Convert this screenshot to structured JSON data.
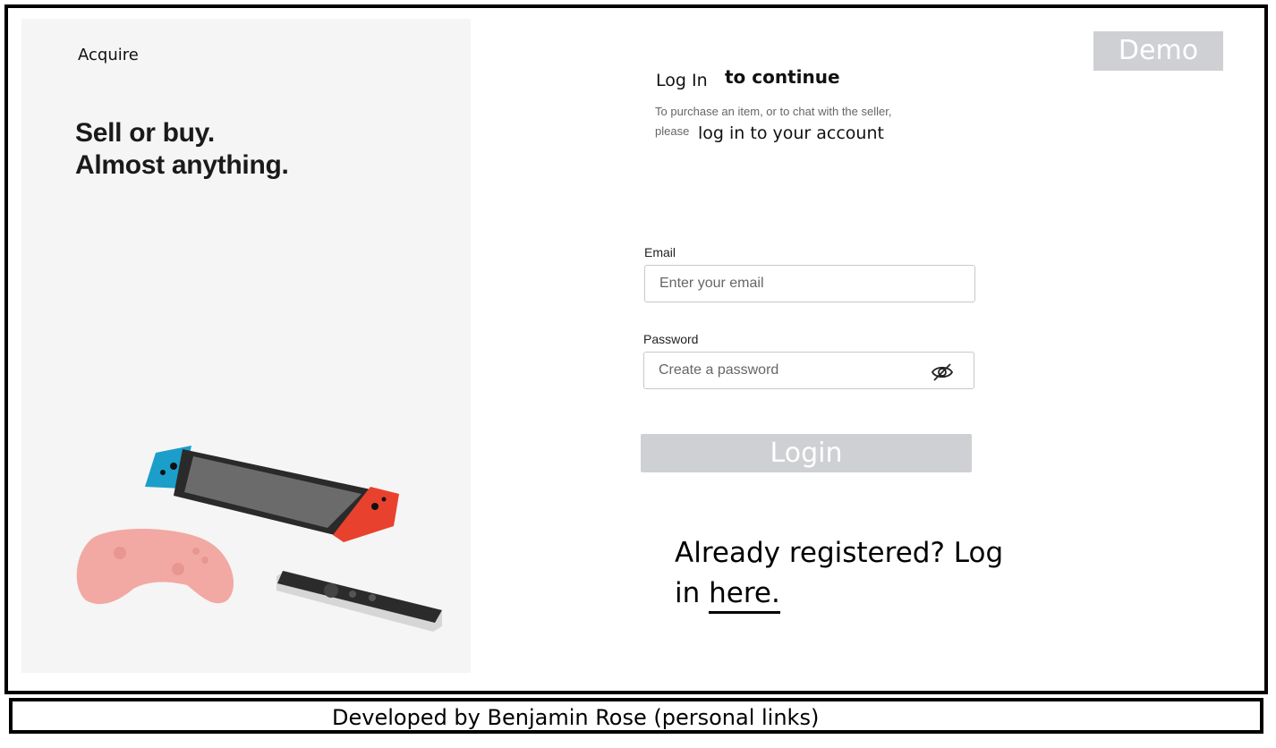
{
  "brand": "Acquire",
  "hero": {
    "line1": "Sell or buy.",
    "line2": "Almost anything."
  },
  "demo_label": "Demo",
  "login": {
    "title": "Log In",
    "title_suffix": "to continue",
    "subtitle_line1": "To purchase an item, or to chat with the seller,",
    "subtitle_please": "please",
    "subtitle_link": "log in to your account"
  },
  "form": {
    "email_label": "Email",
    "email_placeholder": "Enter your email",
    "password_label": "Password",
    "password_placeholder": "Create a password",
    "submit_label": "Login"
  },
  "already": {
    "text": "Already registered? Log in ",
    "link": "here."
  },
  "footer": "Developed by Benjamin Rose  (personal links)",
  "icons": {
    "password_toggle": "eye-off-icon"
  },
  "colors": {
    "button_bg": "#cfd0d3",
    "panel_bg": "#f5f5f5"
  }
}
